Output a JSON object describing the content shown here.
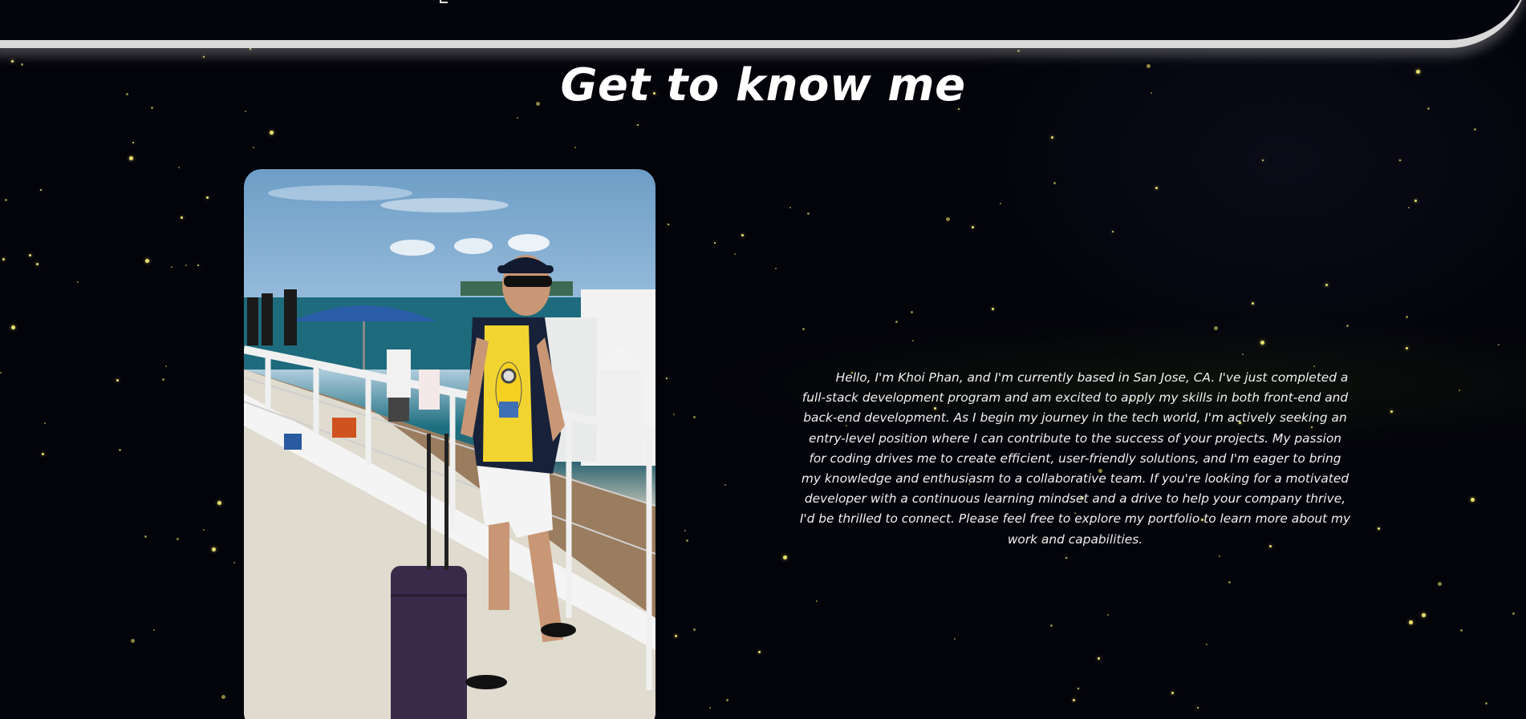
{
  "about": {
    "title": "Get to know me",
    "photo_alt": "Khoi Phan on a pier with a suitcase",
    "bio": "Hello, I'm Khoi Phan, and I'm currently based in San Jose, CA. I've just completed a full-stack development program and am excited to apply my skills in both front-end and back-end development. As I begin my journey in the tech world, I'm actively seeking an entry-level position where I can contribute to the success of your projects. My passion for coding drives me to create efficient, user-friendly solutions, and I'm eager to bring my knowledge and enthusiasm to a collaborative team. If you're looking for a motivated developer with a continuous learning mindset and a drive to help your company thrive, I'd be thrilled to connect. Please feel free to explore my portfolio to learn more about my work and capabilities."
  },
  "colors": {
    "background": "#03030a",
    "star": "#e8e070",
    "text": "#f1f1f1",
    "header_border": "#d9d9d9"
  }
}
